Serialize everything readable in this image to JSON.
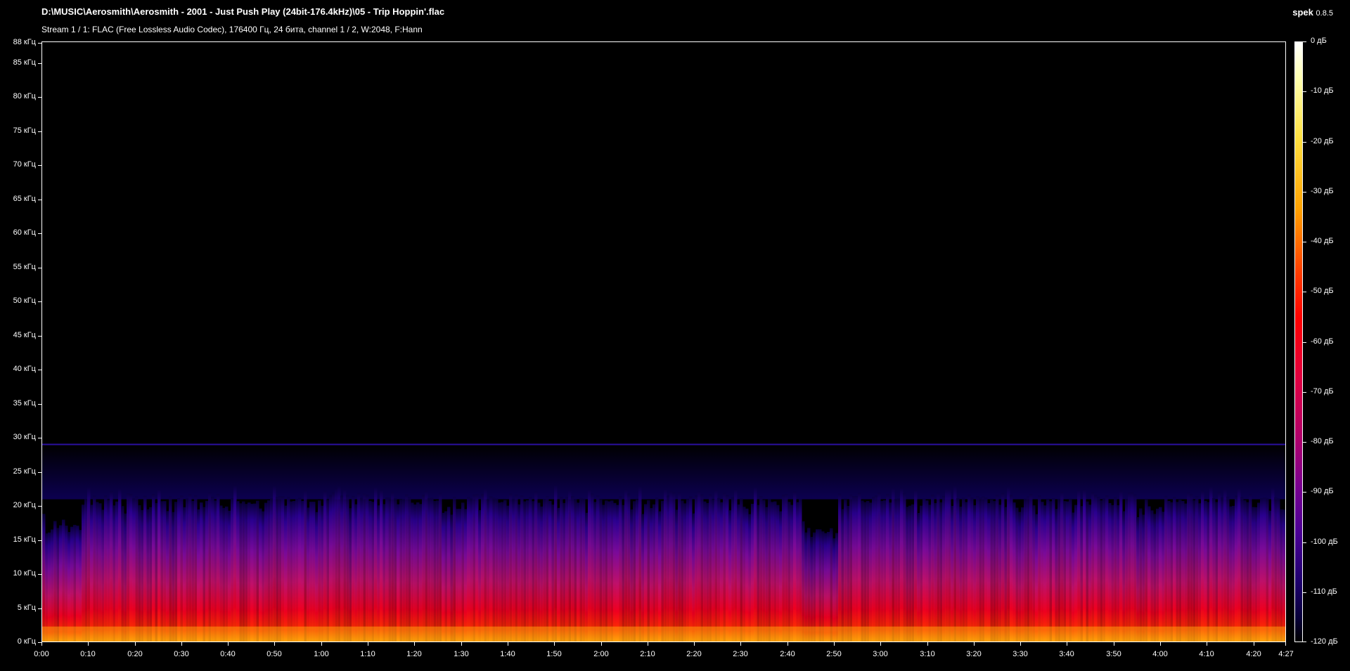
{
  "header": {
    "file_path": "D:\\MUSIC\\Aerosmith\\Aerosmith - 2001 - Just Push Play (24bit-176.4kHz)\\05 - Trip Hoppin'.flac",
    "stream_info": "Stream 1 / 1: FLAC (Free Lossless Audio Codec), 176400 Гц, 24 бита, channel 1 / 2, W:2048, F:Hann",
    "app_name": "spek",
    "app_version": "0.8.5"
  },
  "y_axis": {
    "labels": [
      "88 кГц",
      "85 кГц",
      "80 кГц",
      "75 кГц",
      "70 кГц",
      "65 кГц",
      "60 кГц",
      "55 кГц",
      "50 кГц",
      "45 кГц",
      "40 кГц",
      "35 кГц",
      "30 кГц",
      "25 кГц",
      "20 кГц",
      "15 кГц",
      "10 кГц",
      "5 кГц",
      "0 кГц"
    ],
    "values_khz": [
      88,
      85,
      80,
      75,
      70,
      65,
      60,
      55,
      50,
      45,
      40,
      35,
      30,
      25,
      20,
      15,
      10,
      5,
      0
    ],
    "max_khz": 88.2
  },
  "x_axis": {
    "labels": [
      "0:00",
      "0:10",
      "0:20",
      "0:30",
      "0:40",
      "0:50",
      "1:00",
      "1:10",
      "1:20",
      "1:30",
      "1:40",
      "1:50",
      "2:00",
      "2:10",
      "2:20",
      "2:30",
      "2:40",
      "2:50",
      "3:00",
      "3:10",
      "3:20",
      "3:30",
      "3:40",
      "3:50",
      "4:00",
      "4:10",
      "4:20",
      "4:27"
    ],
    "seconds": [
      0,
      10,
      20,
      30,
      40,
      50,
      60,
      70,
      80,
      90,
      100,
      110,
      120,
      130,
      140,
      150,
      160,
      170,
      180,
      190,
      200,
      210,
      220,
      230,
      240,
      250,
      260,
      267
    ],
    "duration_s": 267
  },
  "color_scale": {
    "labels": [
      "0 дБ",
      "-10 дБ",
      "-20 дБ",
      "-30 дБ",
      "-40 дБ",
      "-50 дБ",
      "-60 дБ",
      "-70 дБ",
      "-80 дБ",
      "-90 дБ",
      "-100 дБ",
      "-110 дБ",
      "-120 дБ"
    ],
    "values_db": [
      0,
      -10,
      -20,
      -30,
      -40,
      -50,
      -60,
      -70,
      -80,
      -90,
      -100,
      -110,
      -120
    ]
  },
  "spectrum": {
    "cutoff_khz": 29,
    "band_top_khz": 23
  }
}
